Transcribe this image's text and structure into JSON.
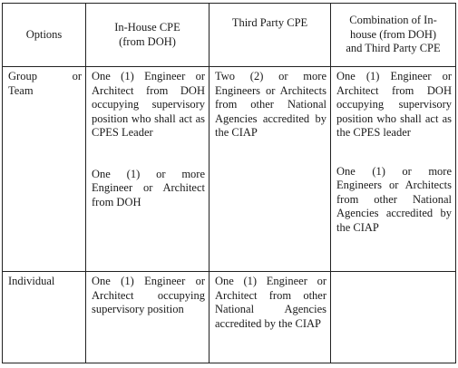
{
  "table": {
    "headers": {
      "options": "Options",
      "inhouse_l1": "In-House CPE",
      "inhouse_l2": "(from DOH)",
      "thirdparty": "Third Party CPE",
      "combo_l1": "Combination of In-",
      "combo_l2": "house (from DOH)",
      "combo_l3": "and Third Party CPE"
    },
    "rows": [
      {
        "option_w1": "Group",
        "option_w2": "or",
        "option_w3": "Team",
        "inhouse_p1": "One (1) Engineer or Architect from DOH occupying supervisory position who shall act as CPES Leader",
        "inhouse_p2": "One (1) or more Engineer or Architect from DOH",
        "thirdparty_p1": "Two (2) or more Engineers or Architects from other National Agencies accredited by the CIAP",
        "combo_p1": "One (1) Engineer or Architect from DOH occupying supervisory position who shall act as the CPES leader",
        "combo_p2": "One (1) or more Engineers or Architects from other National Agencies accredited by the CIAP"
      },
      {
        "option": "Individual",
        "inhouse_p1": "One (1) Engineer or Architect occupying supervisory position",
        "thirdparty_p1": "One (1) Engineer or Architect from other National Agencies accredited by the CIAP",
        "combo_p1": ""
      }
    ]
  }
}
